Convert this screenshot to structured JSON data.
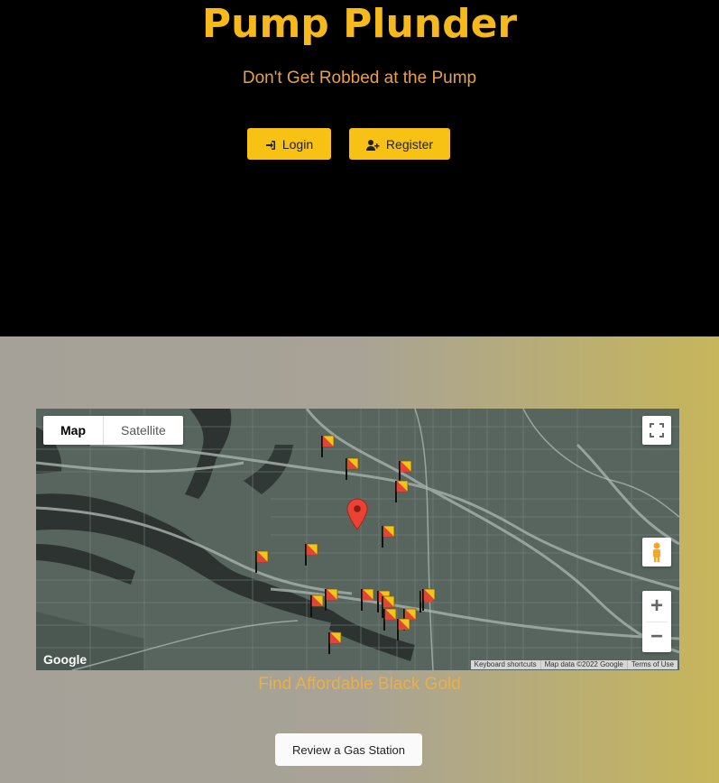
{
  "header": {
    "title": "Pump Plunder",
    "tagline": "Don't Get Robbed at the Pump",
    "login_label": "Login",
    "register_label": "Register"
  },
  "map": {
    "type_map_label": "Map",
    "type_satellite_label": "Satellite",
    "zoom_in_label": "+",
    "zoom_out_label": "−",
    "google_logo": "Google",
    "attribution": {
      "shortcuts": "Keyboard shortcuts",
      "data": "Map data ©2022 Google",
      "terms": "Terms of Use"
    },
    "icons": [
      "fullscreen-icon",
      "pegman-icon",
      "location-pin-icon",
      "gas-station-flag-icon"
    ]
  },
  "main": {
    "tagline": "Find Affordable Black Gold",
    "review_button_label": "Review a Gas Station"
  },
  "colors": {
    "title": "#f6b91c",
    "tagline": "#e8a04a",
    "button": "#f7c213",
    "map_bg": "#56645d"
  }
}
